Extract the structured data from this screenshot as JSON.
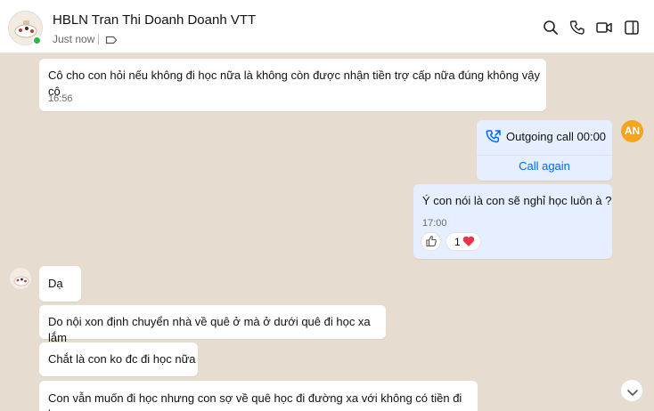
{
  "header": {
    "contact_name": "HBLN Tran Thi Doanh Doanh VTT",
    "status": "Just now",
    "colors": {
      "online": "#32b34a",
      "accent": "#0068ff"
    }
  },
  "icons": [
    "search-icon",
    "phone-icon",
    "video-icon",
    "sidebar-toggle-icon",
    "tag-icon",
    "outgoing-call-icon",
    "like-icon",
    "heart-icon",
    "chevron-down-icon"
  ],
  "messages": [
    {
      "id": "m1",
      "direction": "in",
      "text": "Cô cho con hỏi nếu không đi học nữa là không còn được nhận tiền trợ cấp nữa đúng không vậy cô",
      "time": "16:56"
    },
    {
      "id": "m2",
      "direction": "out",
      "type": "call",
      "text": "Outgoing call 00:00",
      "action": "Call again",
      "sender_initials": "AN"
    },
    {
      "id": "m3",
      "direction": "out",
      "text": "Ý con nói là con sẽ nghỉ học luôn à ?",
      "time": "17:00",
      "reaction_count": "1"
    },
    {
      "id": "m4",
      "direction": "in",
      "text": "Dạ"
    },
    {
      "id": "m5",
      "direction": "in",
      "text": "Do nội xon định chuyển nhà về quê ở mà ở dưới quê đi học xa lắm"
    },
    {
      "id": "m6",
      "direction": "in",
      "text": "Chắt là con ko đc đi học nữa"
    },
    {
      "id": "m7",
      "direction": "in",
      "text": "Con vẫn muốn đi học nhưng con sợ về quê học đi đường xa với không có tiền đi học"
    }
  ]
}
